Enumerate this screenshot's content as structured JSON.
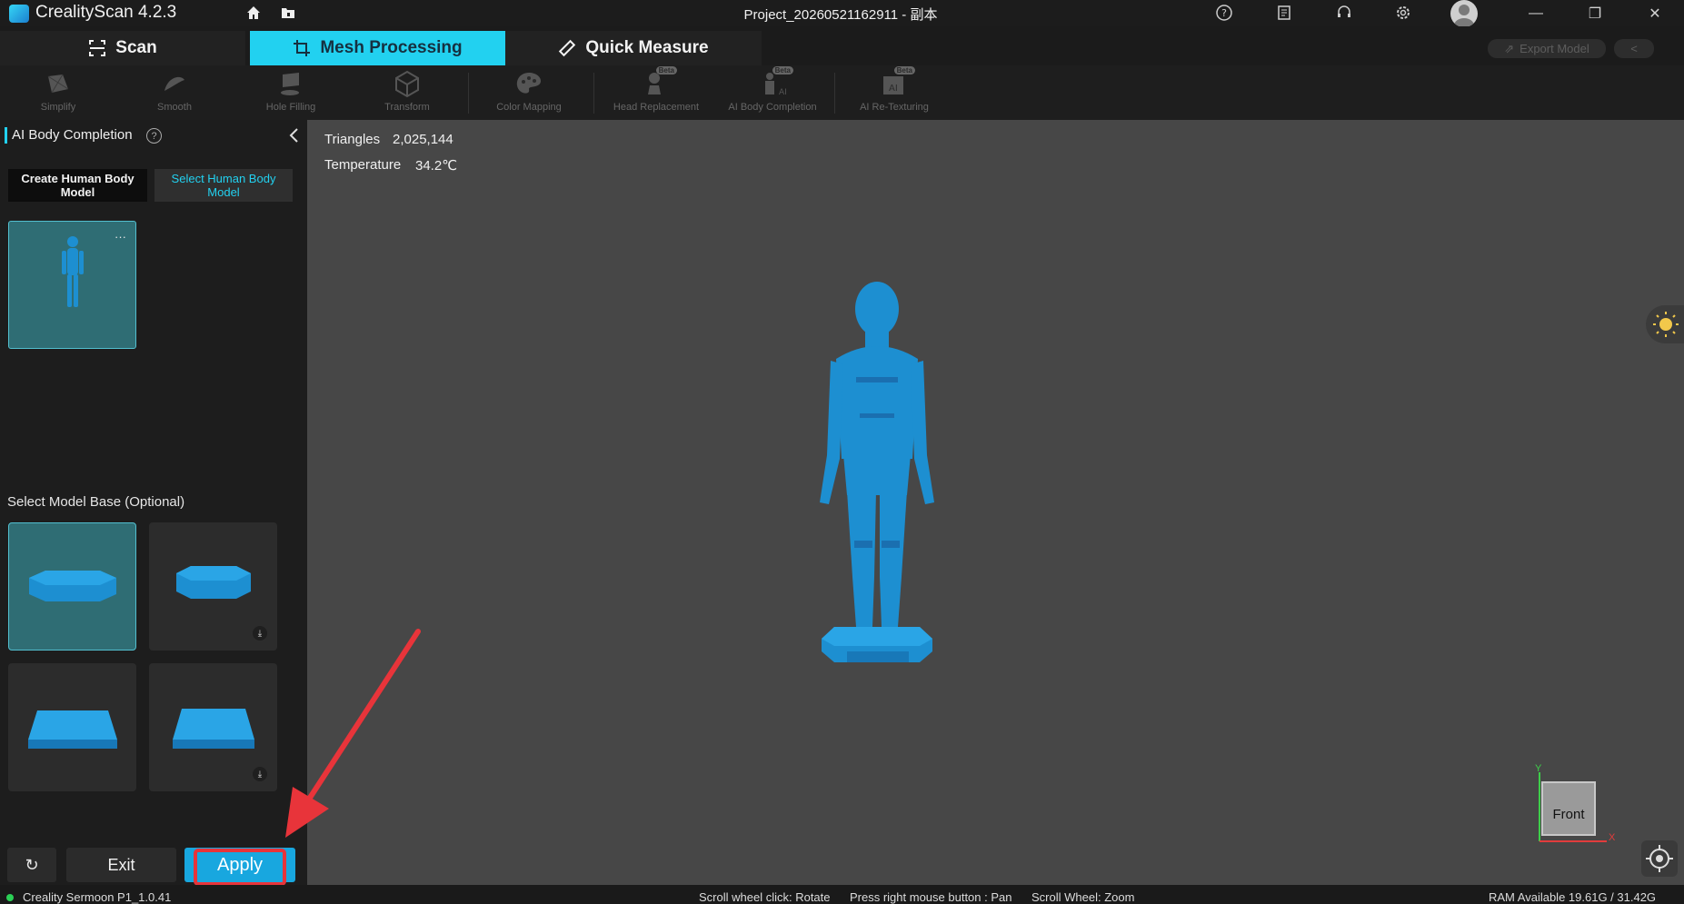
{
  "app": {
    "title": "CrealityScan 4.2.3",
    "project_title": "Project_20260521162911 - 副本"
  },
  "tabs": [
    {
      "label": "Scan"
    },
    {
      "label": "Mesh Processing"
    },
    {
      "label": "Quick Measure"
    }
  ],
  "header_actions": {
    "export_label": "Export Model"
  },
  "toolbar": {
    "beta_badge": "Beta",
    "tools": [
      {
        "label": "Simplify",
        "icon": "simplify-icon"
      },
      {
        "label": "Smooth",
        "icon": "smooth-icon"
      },
      {
        "label": "Hole Filling",
        "icon": "hole-filling-icon"
      },
      {
        "label": "Transform",
        "icon": "transform-icon"
      },
      {
        "label": "Color Mapping",
        "icon": "palette-icon"
      },
      {
        "label": "Head Replacement",
        "icon": "head-replacement-icon"
      },
      {
        "label": "AI Body Completion",
        "icon": "ai-body-icon"
      },
      {
        "label": "AI Re-Texturing",
        "icon": "ai-retexture-icon"
      }
    ]
  },
  "panel": {
    "title": "AI Body Completion",
    "help_glyph": "?",
    "subtabs": {
      "create": "Create Human Body Model",
      "select": "Select Human Body Model"
    },
    "model_menu": "···",
    "base_heading": "Select Model Base (Optional)",
    "buttons": {
      "exit": "Exit",
      "apply": "Apply"
    }
  },
  "viewport": {
    "triangles_label": "Triangles",
    "triangles_value": "2,025,144",
    "temperature_label": "Temperature",
    "temperature_value": "34.2℃",
    "view_label": "Front",
    "axis_y": "Y",
    "axis_x": "X"
  },
  "status": {
    "device": "Creality Sermoon P1_1.0.41",
    "hint_rotate": "Scroll wheel click: Rotate",
    "hint_pan": "Press right mouse button : Pan",
    "hint_zoom": "Scroll Wheel: Zoom",
    "ram": "RAM Available 19.61G / 31.42G"
  },
  "colors": {
    "accent": "#22d1f0",
    "model": "#1d8fd1",
    "highlight": "#e8343a"
  }
}
